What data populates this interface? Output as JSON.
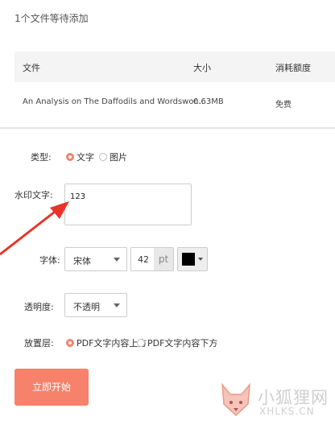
{
  "header": {
    "file_count": "1个文件等待添加"
  },
  "table": {
    "columns": [
      "文件",
      "大小",
      "消耗额度"
    ],
    "rows": [
      {
        "file": "An Analysis on The Daffodils and Wordswor...",
        "size": "0.63MB",
        "cost": "免费"
      }
    ]
  },
  "form": {
    "type_label": "类型:",
    "type_options": [
      {
        "label": "文字",
        "selected": true
      },
      {
        "label": "图片",
        "selected": false
      }
    ],
    "watermark_label": "水印文字:",
    "watermark_value": "123",
    "font_label": "字体:",
    "font_value": "宋体",
    "font_size": "42",
    "font_unit": "pt",
    "font_color": "#000000",
    "opacity_label": "透明度:",
    "opacity_value": "不透明",
    "layer_label": "放置层:",
    "layer_options": [
      {
        "label": "PDF文字内容上方",
        "selected": true
      },
      {
        "label": "PDF文字内容下方",
        "selected": false
      }
    ]
  },
  "start_button": "立即开始",
  "watermark": {
    "cn": "小狐狸网",
    "en": "XHLKS.CN"
  },
  "colors": {
    "accent": "#f6826b",
    "arrow": "#e8332a"
  }
}
